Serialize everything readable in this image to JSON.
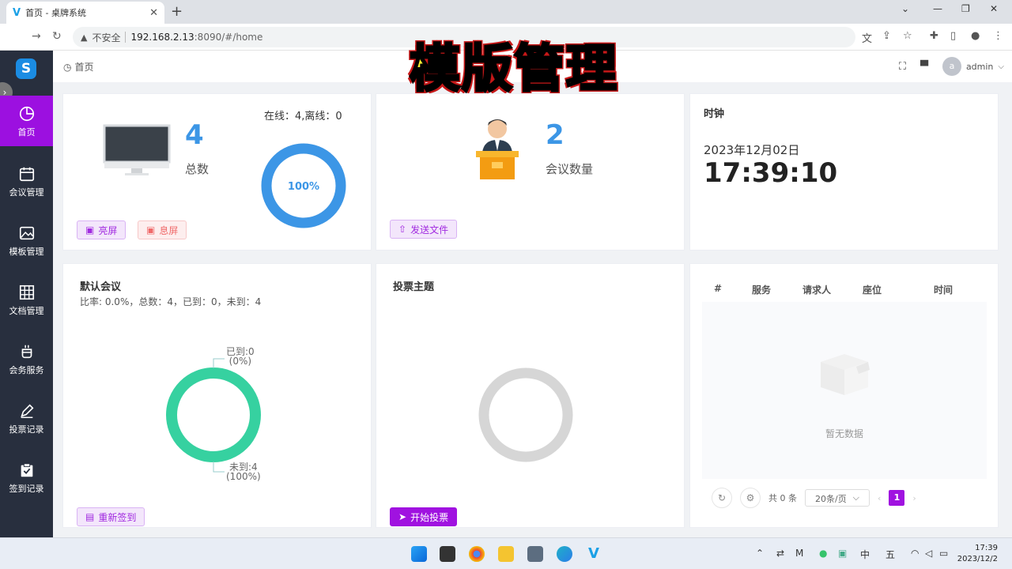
{
  "browser": {
    "tab_title": "首页 - 桌牌系统",
    "insecure_label": "不安全",
    "url_host": "192.168.2.13",
    "url_rest": ":8090/#/home"
  },
  "header": {
    "breadcrumb": "首页",
    "user": "admin",
    "avatar_letter": "a"
  },
  "overlay_title": "模版管理",
  "sidebar": {
    "items": [
      {
        "label": "首页",
        "icon": "pie-chart-icon"
      },
      {
        "label": "会议管理",
        "icon": "calendar-icon"
      },
      {
        "label": "模板管理",
        "icon": "image-icon"
      },
      {
        "label": "文档管理",
        "icon": "grid-icon"
      },
      {
        "label": "会务服务",
        "icon": "cup-icon"
      },
      {
        "label": "投票记录",
        "icon": "pen-icon"
      },
      {
        "label": "签到记录",
        "icon": "clipboard-icon"
      }
    ]
  },
  "devices": {
    "count": "4",
    "label": "总数",
    "status": "在线：4,离线：0",
    "percent_label": "100%",
    "online_fraction": 1.0,
    "btn_on": "亮屏",
    "btn_off": "息屏"
  },
  "meetings": {
    "count": "2",
    "label": "会议数量",
    "btn_send": "发送文件"
  },
  "clock": {
    "title": "时钟",
    "date": "2023年12月02日",
    "time": "17:39:10"
  },
  "default_meeting": {
    "title": "默认会议",
    "stats": "比率: 0.0%，总数：4，已到：0，未到：4",
    "arrived_label": "已到:0",
    "arrived_pct": "(0%)",
    "absent_label": "未到:4",
    "absent_pct": "(100%)",
    "btn_resign": "重新签到"
  },
  "vote": {
    "title": "投票主题",
    "btn_start": "开始投票"
  },
  "service_table": {
    "columns": [
      "#",
      "服务",
      "请求人",
      "座位",
      "时间"
    ],
    "empty_text": "暂无数据",
    "total": "共 0 条",
    "page_size": "20条/页",
    "current_page": "1"
  },
  "taskbar": {
    "ime_zh": "中",
    "ime_day": "五",
    "time": "17:39",
    "date": "2023/12/2"
  },
  "colors": {
    "accent": "#9c10e0",
    "blue": "#3c96e6",
    "green": "#36d1a0",
    "sidebar": "#282f3e"
  }
}
